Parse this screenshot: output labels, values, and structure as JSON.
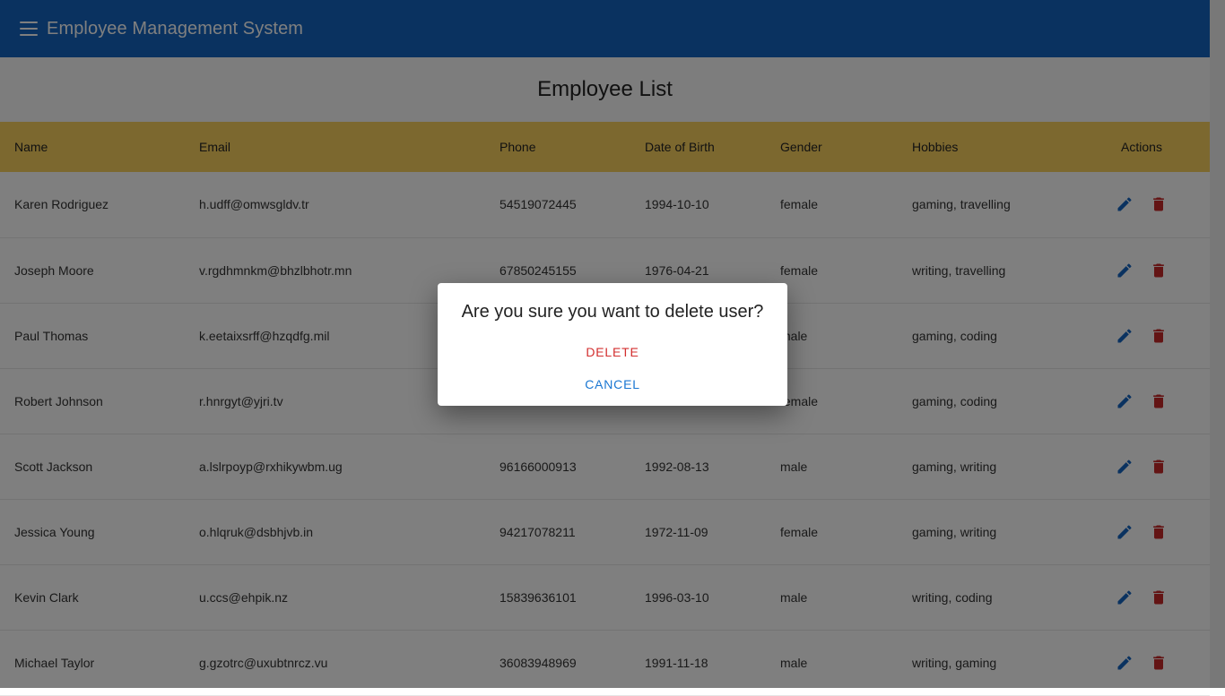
{
  "appbar": {
    "title": "Employee Management System"
  },
  "page": {
    "title": "Employee List"
  },
  "table": {
    "columns": [
      "Name",
      "Email",
      "Phone",
      "Date of Birth",
      "Gender",
      "Hobbies",
      "Actions"
    ],
    "rows": [
      {
        "name": "Karen Rodriguez",
        "email": "h.udff@omwsgldv.tr",
        "phone": "54519072445",
        "dob": "1994-10-10",
        "gender": "female",
        "hobbies": "gaming, travelling"
      },
      {
        "name": "Joseph Moore",
        "email": "v.rgdhmnkm@bhzlbhotr.mn",
        "phone": "67850245155",
        "dob": "1976-04-21",
        "gender": "female",
        "hobbies": "writing, travelling"
      },
      {
        "name": "Paul Thomas",
        "email": "k.eetaixsrff@hzqdfg.mil",
        "phone": "",
        "dob": "",
        "gender": "male",
        "hobbies": "gaming, coding"
      },
      {
        "name": "Robert Johnson",
        "email": "r.hnrgyt@yjri.tv",
        "phone": "",
        "dob": "",
        "gender": "female",
        "hobbies": "gaming, coding"
      },
      {
        "name": "Scott Jackson",
        "email": "a.lslrpoyp@rxhikywbm.ug",
        "phone": "96166000913",
        "dob": "1992-08-13",
        "gender": "male",
        "hobbies": "gaming, writing"
      },
      {
        "name": "Jessica Young",
        "email": "o.hlqruk@dsbhjvb.in",
        "phone": "94217078211",
        "dob": "1972-11-09",
        "gender": "female",
        "hobbies": "gaming, writing"
      },
      {
        "name": "Kevin Clark",
        "email": "u.ccs@ehpik.nz",
        "phone": "15839636101",
        "dob": "1996-03-10",
        "gender": "male",
        "hobbies": "writing, coding"
      },
      {
        "name": "Michael Taylor",
        "email": "g.gzotrc@uxubtnrcz.vu",
        "phone": "36083948969",
        "dob": "1991-11-18",
        "gender": "male",
        "hobbies": "writing, gaming"
      }
    ]
  },
  "dialog": {
    "message": "Are you sure you want to delete user?",
    "confirm_label": "DELETE",
    "cancel_label": "CANCEL"
  },
  "icons": {
    "menu": "menu-icon",
    "edit": "edit-icon",
    "delete": "delete-icon"
  },
  "colors": {
    "appbar": "#1565c0",
    "header_row": "#f9d05f",
    "edit_icon": "#1565c0",
    "delete_icon": "#c62828",
    "delete_text": "#d32f2f",
    "cancel_text": "#1976d2"
  }
}
